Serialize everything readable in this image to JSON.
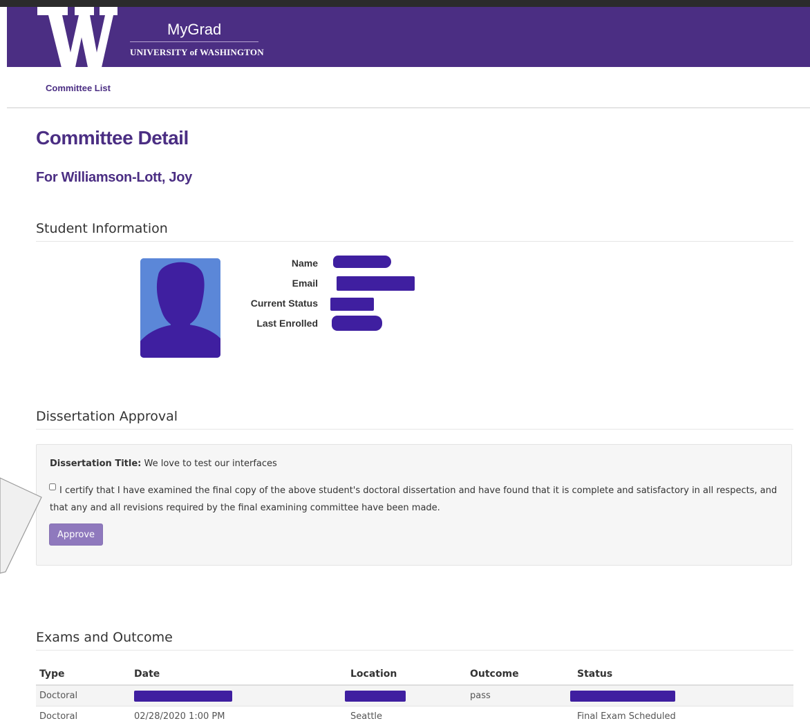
{
  "header": {
    "app_title": "MyGrad",
    "university": "UNIVERSITY of WASHINGTON",
    "brand_color": "#4b2e83",
    "logo_icon": "uw-w-logo-icon"
  },
  "nav": {
    "committee_list": "Committee List"
  },
  "page": {
    "title": "Committee Detail",
    "subtitle": "For Williamson-Lott, Joy"
  },
  "student_info": {
    "heading": "Student Information",
    "photo_icon": "student-photo-silhouette-icon",
    "labels": {
      "name": "Name",
      "email": "Email",
      "current_status": "Current Status",
      "last_enrolled": "Last Enrolled"
    }
  },
  "dissertation": {
    "heading": "Dissertation Approval",
    "title_label": "Dissertation Title:",
    "title_value": "We love to test our interfaces",
    "certify_text": "I certify that I have examined the final copy of the above student's doctoral dissertation and have found that it is complete and satisfactory in all respects, and that any and all revisions required by the final examining committee have been made.",
    "certify_checked": false,
    "approve_label": "Approve"
  },
  "exams": {
    "heading": "Exams and Outcome",
    "columns": [
      "Type",
      "Date",
      "Location",
      "Outcome",
      "Status"
    ],
    "rows": [
      {
        "type": "Doctoral",
        "date": "",
        "location": "",
        "outcome": "pass",
        "status": ""
      },
      {
        "type": "Doctoral",
        "date": "02/28/2020 1:00 PM",
        "location": "Seattle",
        "outcome": "",
        "status": "Final Exam Scheduled"
      }
    ]
  }
}
